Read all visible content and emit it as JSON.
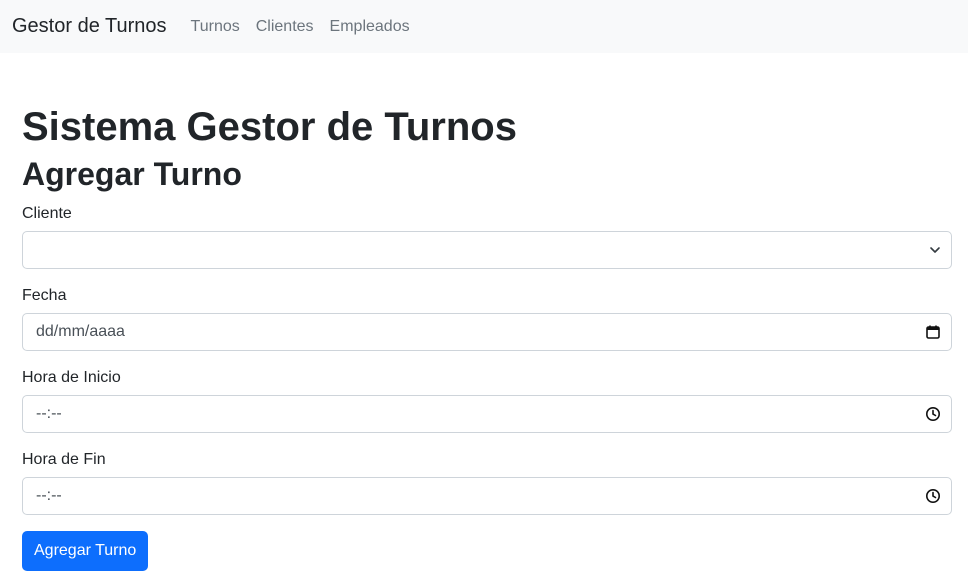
{
  "navbar": {
    "brand": "Gestor de Turnos",
    "links": [
      "Turnos",
      "Clientes",
      "Empleados"
    ]
  },
  "page": {
    "title": "Sistema Gestor de Turnos",
    "subtitle": "Agregar Turno"
  },
  "form": {
    "cliente": {
      "label": "Cliente",
      "value": ""
    },
    "fecha": {
      "label": "Fecha",
      "placeholder": "dd/mm/aaaa"
    },
    "hora_inicio": {
      "label": "Hora de Inicio",
      "placeholder": "--:--"
    },
    "hora_fin": {
      "label": "Hora de Fin",
      "placeholder": "--:--"
    },
    "submit_label": "Agregar Turno"
  },
  "colors": {
    "navbar_bg": "#f8f9fa",
    "primary": "#0d6efd",
    "border": "#ced4da"
  },
  "icons": {
    "select": "chevron-down-icon",
    "date": "calendar-icon",
    "time": "clock-icon"
  }
}
